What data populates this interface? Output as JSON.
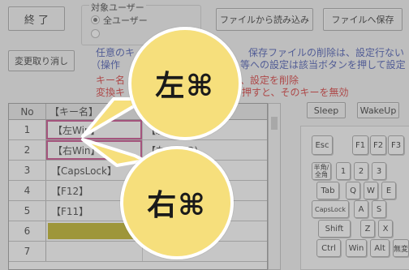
{
  "toolbar": {
    "exit_label": "終 了",
    "undo_label": "変更取り消し",
    "load_label": "ファイルから読み込み",
    "save_label": "ファイルへ保存"
  },
  "target_user": {
    "title": "対象ユーザー",
    "option_all": "全ユーザー"
  },
  "notes": {
    "line1": "任意のキ",
    "line1b": "定",
    "line1c": "保存ファイルの削除は、設定行ない",
    "line2": "（操作",
    "line2b": "等への設定は該当ボタンを押して設定",
    "line3": "キー名",
    "line3b": "、設定を削除",
    "line4": "変換キ",
    "line4b": "押すと、そのキーを無効"
  },
  "table": {
    "headers": [
      "No",
      "【キー名】"
    ],
    "rows": [
      {
        "no": "1",
        "key": "【左Win】",
        "value": "【左Co"
      },
      {
        "no": "2",
        "key": "【右Win】",
        "value": "【左Co(LR)"
      },
      {
        "no": "3",
        "key": "【CapsLock】",
        "value": ""
      },
      {
        "no": "4",
        "key": "【F12】",
        "value": ""
      },
      {
        "no": "5",
        "key": "【F11】",
        "value": ""
      },
      {
        "no": "6",
        "key": "",
        "value": ""
      },
      {
        "no": "7",
        "key": "",
        "value": ""
      }
    ]
  },
  "special_buttons": {
    "sleep": "Sleep",
    "wakeup": "WakeUp"
  },
  "keyboard": {
    "keys": [
      "Esc",
      "F1",
      "F2",
      "F3",
      "半角/全角",
      "1",
      "2",
      "3",
      "Tab",
      "Q",
      "W",
      "E",
      "CapsLock",
      "A",
      "S",
      "Shift",
      "Z",
      "X",
      "Ctrl",
      "Win",
      "Alt",
      "無変"
    ]
  },
  "bubbles": {
    "left": "左⌘",
    "right": "右⌘"
  },
  "colors": {
    "highlight_cell": "#b7a800",
    "selection_border": "#c1307a",
    "bubble_fill": "#f6df7c",
    "note_blue": "#2a3ea6",
    "note_red": "#d21a1a"
  }
}
